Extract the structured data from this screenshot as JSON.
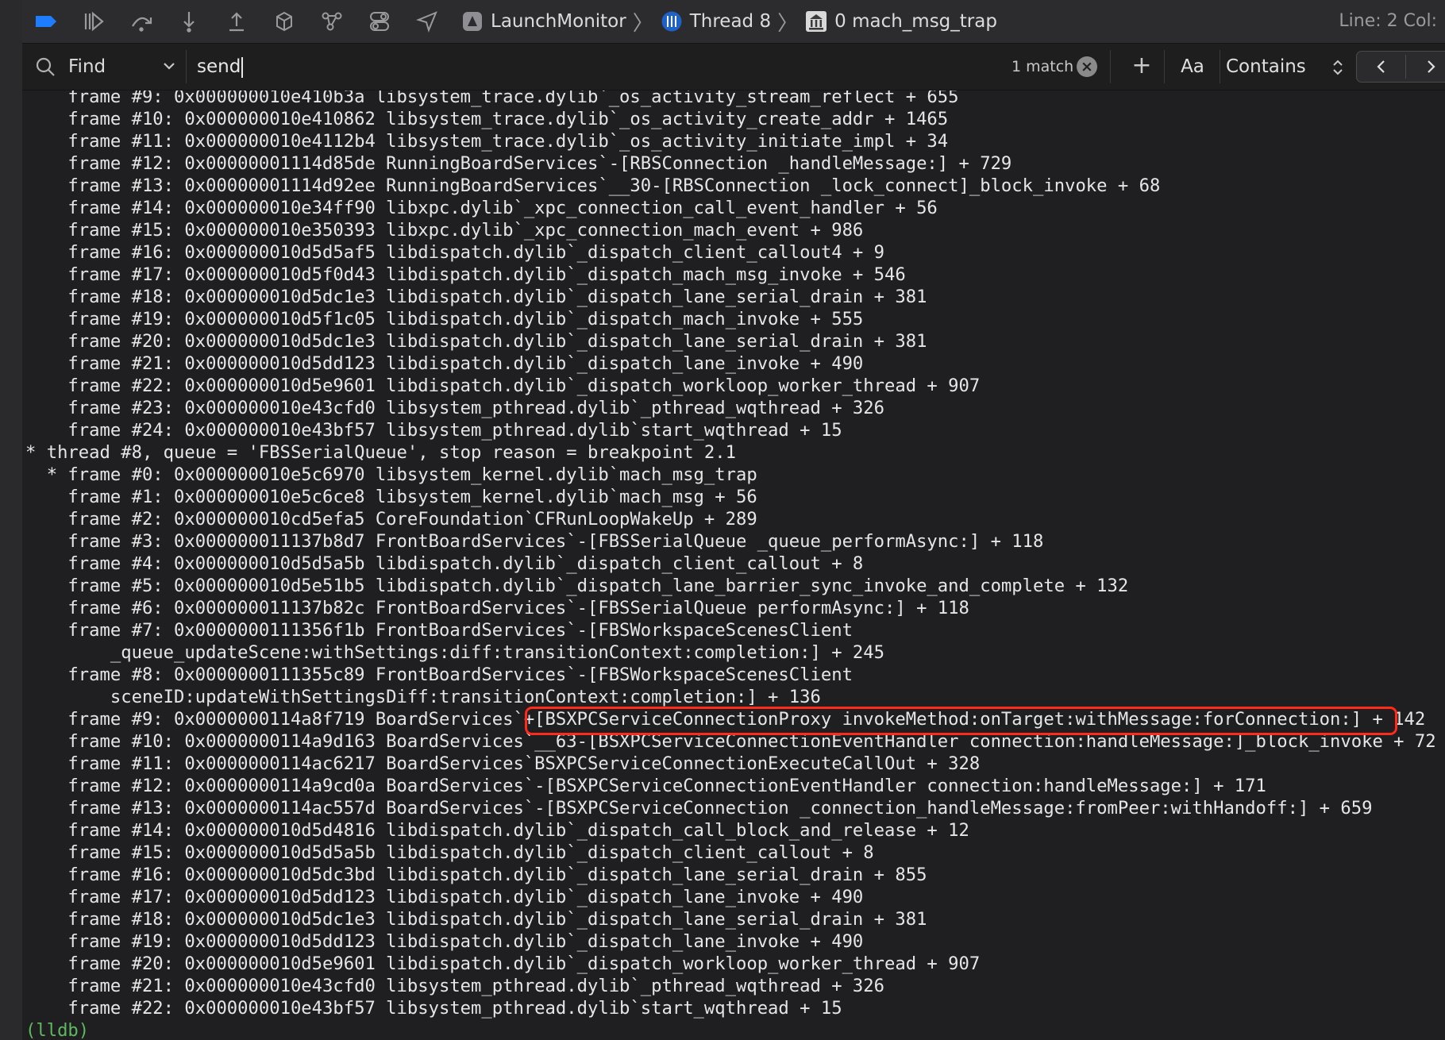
{
  "toolbar": {
    "icons": [
      "breakpoints-toggle-icon",
      "continue-icon",
      "step-over-icon",
      "step-into-icon",
      "step-out-icon",
      "view-hierarchy-icon",
      "memory-graph-icon",
      "environment-overrides-icon",
      "simulate-location-icon"
    ],
    "breadcrumb": [
      {
        "label": "LaunchMonitor",
        "icon": "app-icon"
      },
      {
        "label": "Thread 8",
        "icon": "thread-icon"
      },
      {
        "label": "0 mach_msg_trap",
        "icon": "frame-icon"
      }
    ],
    "line_col": "Line: 2  Col:"
  },
  "find_bar": {
    "mode": "Find",
    "query": "send",
    "match_count": "1 match",
    "case_label": "Aa",
    "match_type": "Contains",
    "plus_label": "+"
  },
  "colors": {
    "background": "#1f1f21",
    "text": "#e6e6e6",
    "prompt": "#5fb85f",
    "highlight_box": "#ff2a1a",
    "accent": "#1e7dff"
  },
  "console": {
    "lines": [
      "    frame #9: 0x000000010e410b3a libsystem_trace.dylib`_os_activity_stream_reflect + 655",
      "    frame #10: 0x000000010e410862 libsystem_trace.dylib`_os_activity_create_addr + 1465",
      "    frame #11: 0x000000010e4112b4 libsystem_trace.dylib`_os_activity_initiate_impl + 34",
      "    frame #12: 0x00000001114d85de RunningBoardServices`-[RBSConnection _handleMessage:] + 729",
      "    frame #13: 0x00000001114d92ee RunningBoardServices`__30-[RBSConnection _lock_connect]_block_invoke + 68",
      "    frame #14: 0x000000010e34ff90 libxpc.dylib`_xpc_connection_call_event_handler + 56",
      "    frame #15: 0x000000010e350393 libxpc.dylib`_xpc_connection_mach_event + 986",
      "    frame #16: 0x000000010d5d5af5 libdispatch.dylib`_dispatch_client_callout4 + 9",
      "    frame #17: 0x000000010d5f0d43 libdispatch.dylib`_dispatch_mach_msg_invoke + 546",
      "    frame #18: 0x000000010d5dc1e3 libdispatch.dylib`_dispatch_lane_serial_drain + 381",
      "    frame #19: 0x000000010d5f1c05 libdispatch.dylib`_dispatch_mach_invoke + 555",
      "    frame #20: 0x000000010d5dc1e3 libdispatch.dylib`_dispatch_lane_serial_drain + 381",
      "    frame #21: 0x000000010d5dd123 libdispatch.dylib`_dispatch_lane_invoke + 490",
      "    frame #22: 0x000000010d5e9601 libdispatch.dylib`_dispatch_workloop_worker_thread + 907",
      "    frame #23: 0x000000010e43cfd0 libsystem_pthread.dylib`_pthread_wqthread + 326",
      "    frame #24: 0x000000010e43bf57 libsystem_pthread.dylib`start_wqthread + 15",
      "* thread #8, queue = 'FBSSerialQueue', stop reason = breakpoint 2.1",
      "  * frame #0: 0x000000010e5c6970 libsystem_kernel.dylib`mach_msg_trap",
      "    frame #1: 0x000000010e5c6ce8 libsystem_kernel.dylib`mach_msg + 56",
      "    frame #2: 0x000000010cd5efa5 CoreFoundation`CFRunLoopWakeUp + 289",
      "    frame #3: 0x000000011137b8d7 FrontBoardServices`-[FBSSerialQueue _queue_performAsync:] + 118",
      "    frame #4: 0x000000010d5d5a5b libdispatch.dylib`_dispatch_client_callout + 8",
      "    frame #5: 0x000000010d5e51b5 libdispatch.dylib`_dispatch_lane_barrier_sync_invoke_and_complete + 132",
      "    frame #6: 0x000000011137b82c FrontBoardServices`-[FBSSerialQueue performAsync:] + 118",
      "    frame #7: 0x0000000111356f1b FrontBoardServices`-[FBSWorkspaceScenesClient",
      "        _queue_updateScene:withSettings:diff:transitionContext:completion:] + 245",
      "    frame #8: 0x0000000111355c89 FrontBoardServices`-[FBSWorkspaceScenesClient",
      "        sceneID:updateWithSettingsDiff:transitionContext:completion:] + 136",
      "    frame #9: 0x0000000114a8f719 BoardServices`+[BSXPCServiceConnectionProxy invokeMethod:onTarget:withMessage:forConnection:] + 142",
      "    frame #10: 0x0000000114a9d163 BoardServices`__63-[BSXPCServiceConnectionEventHandler connection:handleMessage:]_block_invoke + 72",
      "    frame #11: 0x0000000114ac6217 BoardServices`BSXPCServiceConnectionExecuteCallOut + 328",
      "    frame #12: 0x0000000114a9cd0a BoardServices`-[BSXPCServiceConnectionEventHandler connection:handleMessage:] + 171",
      "    frame #13: 0x0000000114ac557d BoardServices`-[BSXPCServiceConnection _connection_handleMessage:fromPeer:withHandoff:] + 659",
      "    frame #14: 0x000000010d5d4816 libdispatch.dylib`_dispatch_call_block_and_release + 12",
      "    frame #15: 0x000000010d5d5a5b libdispatch.dylib`_dispatch_client_callout + 8",
      "    frame #16: 0x000000010d5dc3bd libdispatch.dylib`_dispatch_lane_serial_drain + 855",
      "    frame #17: 0x000000010d5dd123 libdispatch.dylib`_dispatch_lane_invoke + 490",
      "    frame #18: 0x000000010d5dc1e3 libdispatch.dylib`_dispatch_lane_serial_drain + 381",
      "    frame #19: 0x000000010d5dd123 libdispatch.dylib`_dispatch_lane_invoke + 490",
      "    frame #20: 0x000000010d5e9601 libdispatch.dylib`_dispatch_workloop_worker_thread + 907",
      "    frame #21: 0x000000010e43cfd0 libsystem_pthread.dylib`_pthread_wqthread + 326",
      "    frame #22: 0x000000010e43bf57 libsystem_pthread.dylib`start_wqthread + 15"
    ],
    "prompt": "(lldb)"
  }
}
